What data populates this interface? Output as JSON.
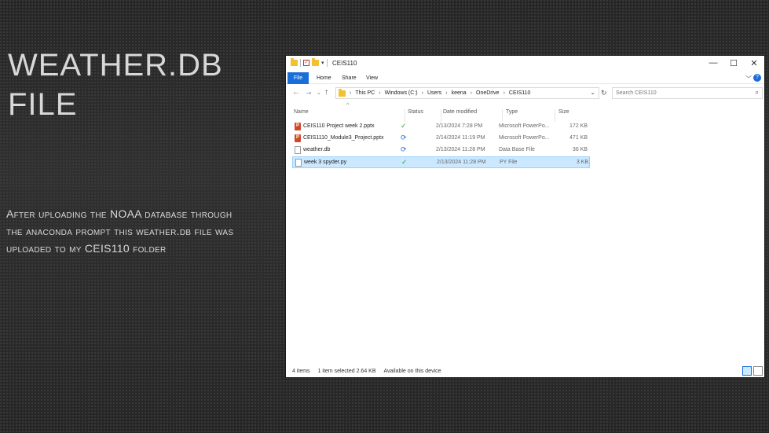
{
  "slide": {
    "title_line1": "WEATHER.DB",
    "title_line2": "FILE",
    "body": "After uploading the NOAA database through the anaconda prompt this weather.db file was uploaded to my CEIS110 folder"
  },
  "window": {
    "title": "CEIS110",
    "controls": {
      "minimize": "—",
      "maximize": "☐",
      "close": "✕"
    },
    "ribbon_tabs": [
      "File",
      "Home",
      "Share",
      "View"
    ],
    "help": "?",
    "breadcrumb": [
      "This PC",
      "Windows (C:)",
      "Users",
      "keena",
      "OneDrive",
      "CEIS110"
    ],
    "search_placeholder": "Search CEIS110",
    "columns": {
      "name": "Name",
      "status": "Status",
      "date": "Date modified",
      "type": "Type",
      "size": "Size"
    },
    "files": [
      {
        "name": "CEIS110 Project week 2.pptx",
        "status": "✓",
        "date": "2/13/2024 7:28 PM",
        "type": "Microsoft PowerPo...",
        "size": "172 KB",
        "icon": "powerpoint-icon"
      },
      {
        "name": "CEIS1110_Module3_Project.pptx",
        "status": "⟳",
        "date": "2/14/2024 11:19 PM",
        "type": "Microsoft PowerPo...",
        "size": "471 KB",
        "icon": "powerpoint-icon"
      },
      {
        "name": "weather.db",
        "status": "⟳",
        "date": "2/13/2024 11:28 PM",
        "type": "Data Base File",
        "size": "36 KB",
        "icon": "file-icon"
      },
      {
        "name": "week 3 spyder.py",
        "status": "✓",
        "date": "2/13/2024 11:28 PM",
        "type": "PY File",
        "size": "3 KB",
        "icon": "python-file-icon"
      }
    ],
    "status_bar": {
      "count": "4 items",
      "selected": "1 item selected  2.64 KB",
      "availability": "Available on this device"
    }
  }
}
